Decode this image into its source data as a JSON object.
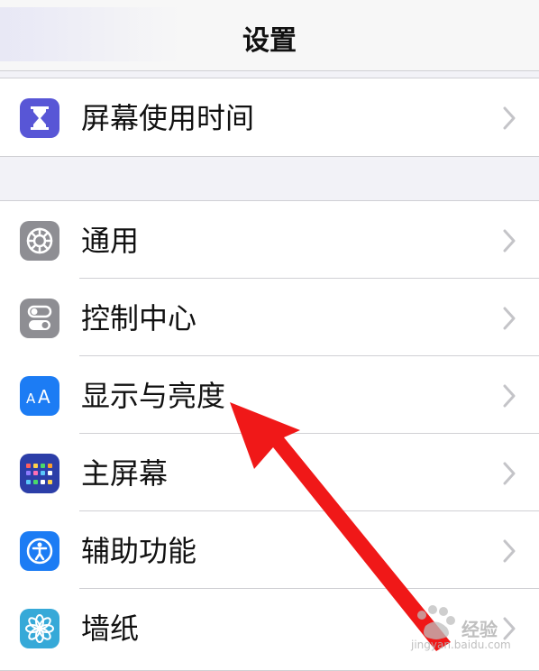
{
  "header": {
    "title": "设置"
  },
  "groups": [
    {
      "items": [
        {
          "label": "屏幕使用时间",
          "icon": "hourglass-icon",
          "color": "#5856d6"
        }
      ]
    },
    {
      "items": [
        {
          "label": "通用",
          "icon": "gear-icon",
          "color": "#8e8e93"
        },
        {
          "label": "控制中心",
          "icon": "toggles-icon",
          "color": "#8e8e93"
        },
        {
          "label": "显示与亮度",
          "icon": "text-size-icon",
          "color": "#1c7cf4"
        },
        {
          "label": "主屏幕",
          "icon": "home-screen-icon",
          "color": "#2c3ea8"
        },
        {
          "label": "辅助功能",
          "icon": "accessibility-icon",
          "color": "#1c7cf4"
        },
        {
          "label": "墙纸",
          "icon": "flower-icon",
          "color": "#36a9d8"
        }
      ]
    }
  ],
  "annotation": {
    "arrow_color": "#f01818"
  },
  "watermark": {
    "brand": "经验",
    "url": "jingyan.baidu.com"
  }
}
